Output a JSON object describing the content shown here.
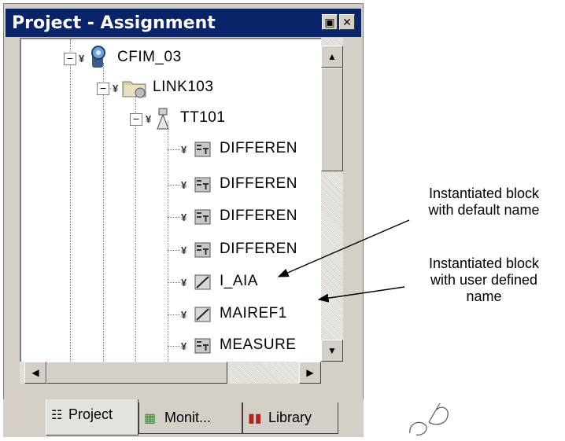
{
  "panel": {
    "title": "Project - Assignment",
    "title_buttons": {
      "pin": "▣",
      "close": "✕"
    }
  },
  "tree": {
    "nodes": [
      {
        "label": "CFIM_03",
        "icon": "device-icon",
        "expanded_symbol": "−"
      },
      {
        "label": "LINK103",
        "icon": "link-folder-icon",
        "expanded_symbol": "−"
      },
      {
        "label": "TT101",
        "icon": "transmitter-icon",
        "expanded_symbol": "−"
      },
      {
        "label": "DIFFEREN",
        "icon": "function-block-icon"
      },
      {
        "label": "DIFFEREN",
        "icon": "function-block-icon"
      },
      {
        "label": "DIFFEREN",
        "icon": "function-block-icon"
      },
      {
        "label": "DIFFEREN",
        "icon": "function-block-icon"
      },
      {
        "label": "I_AIA",
        "icon": "analog-block-icon"
      },
      {
        "label": "MAIREF1",
        "icon": "analog-block-icon"
      },
      {
        "label": "MEASURE",
        "icon": "function-block-icon"
      }
    ]
  },
  "scrollbars": {
    "up": "▲",
    "down": "▼",
    "left": "◀",
    "right": "▶"
  },
  "tabs": [
    {
      "label": "Project",
      "icon": "project-tree-icon",
      "active": true
    },
    {
      "label": "Monit...",
      "icon": "monitor-icon",
      "active": false
    },
    {
      "label": "Library",
      "icon": "library-books-icon",
      "active": false
    }
  ],
  "annotations": {
    "default_name": [
      "Instantiated block",
      "with default name"
    ],
    "user_defined": [
      "Instantiated block",
      "with user defined",
      "name"
    ]
  },
  "colors": {
    "titlebar": "#0a246a",
    "face": "#d4d0c8",
    "text": "#000000"
  }
}
